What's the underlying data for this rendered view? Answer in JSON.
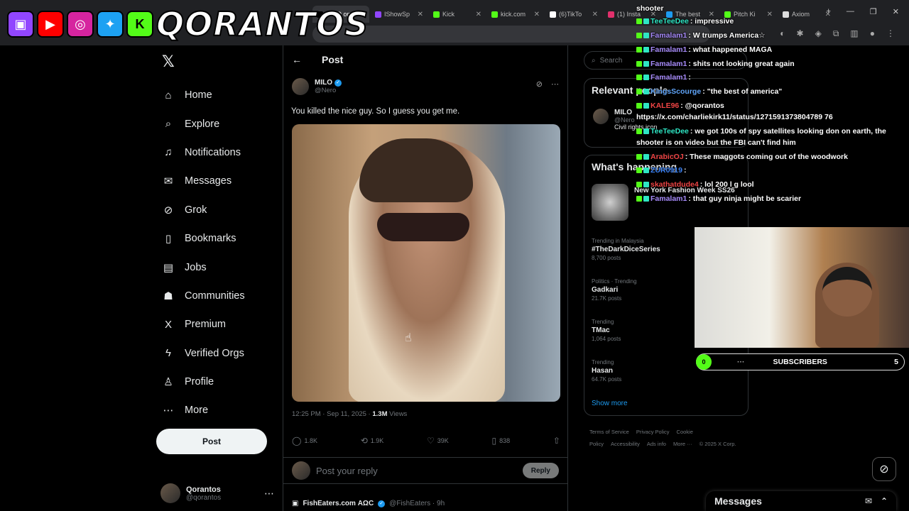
{
  "browser": {
    "tabs": [
      {
        "label": "MILO on",
        "color": "#000000",
        "active": true
      },
      {
        "label": "IShowSp",
        "color": "#9146ff",
        "active": false
      },
      {
        "label": "Kick",
        "color": "#53fc18",
        "active": false
      },
      {
        "label": "kick.com",
        "color": "#53fc18",
        "active": false
      },
      {
        "label": "(6)TikTo",
        "color": "#ffffff",
        "active": false
      },
      {
        "label": "(1) Insta",
        "color": "#e1306c",
        "active": false
      },
      {
        "label": "The best",
        "color": "#1d9bf0",
        "active": false
      },
      {
        "label": "Pitch Ki",
        "color": "#53fc18",
        "active": false
      },
      {
        "label": "Axiom",
        "color": "#dddddd",
        "active": false
      }
    ]
  },
  "overlay": {
    "brand": "QORANTOS"
  },
  "nav": {
    "items": [
      {
        "label": "Home",
        "icon": "⌂",
        "name": "home"
      },
      {
        "label": "Explore",
        "icon": "⌕",
        "name": "explore"
      },
      {
        "label": "Notifications",
        "icon": "♫",
        "name": "notifications"
      },
      {
        "label": "Messages",
        "icon": "✉",
        "name": "messages"
      },
      {
        "label": "Grok",
        "icon": "⊘",
        "name": "grok"
      },
      {
        "label": "Bookmarks",
        "icon": "▯",
        "name": "bookmarks"
      },
      {
        "label": "Jobs",
        "icon": "▤",
        "name": "jobs"
      },
      {
        "label": "Communities",
        "icon": "☗",
        "name": "communities"
      },
      {
        "label": "Premium",
        "icon": "X",
        "name": "premium"
      },
      {
        "label": "Verified Orgs",
        "icon": "ϟ",
        "name": "verified-orgs"
      },
      {
        "label": "Profile",
        "icon": "♙",
        "name": "profile"
      },
      {
        "label": "More",
        "icon": "⋯",
        "name": "more"
      }
    ],
    "post_label": "Post",
    "user": {
      "name": "Qorantos",
      "handle": "@qorantos"
    }
  },
  "post": {
    "header": "Post",
    "author": "MILO",
    "handle": "@Nero",
    "text": "You killed the nice guy. So I guess you get me.",
    "time": "12:25 PM · Sep 11, 2025 · ",
    "views": "1.3M",
    "views_label": " Views",
    "replies": "1.8K",
    "reposts": "1.9K",
    "likes": "39K",
    "bookmarks": "838",
    "reply_placeholder": "Post your reply",
    "reply_label": "Reply",
    "next_author": "FishEaters.com ΑΩϹ",
    "next_meta": "@FishEaters · 9h"
  },
  "sidebar": {
    "search": "Search",
    "relevant_title": "Relevant people",
    "relevant_name": "MILO",
    "relevant_handle": "@Nero",
    "relevant_bio": "Civil rights icon",
    "happening_title": "What's happening",
    "fashion": "New York Fashion Week SS26",
    "trends": [
      {
        "context": "Trending in Malaysia",
        "title": "#TheDarkDiceSeries",
        "count": "8,700 posts"
      },
      {
        "context": "Politics · Trending",
        "title": "Gadkari",
        "count": "21.7K posts"
      },
      {
        "context": "Trending",
        "title": "TMac",
        "count": "1,064 posts"
      },
      {
        "context": "Trending",
        "title": "Hasan",
        "count": "64.7K posts"
      }
    ],
    "show_more": "Show more",
    "footer": [
      "Terms of Service",
      "Privacy Policy",
      "Cookie Policy",
      "Accessibility",
      "Ads info",
      "More ···",
      "© 2025 X Corp."
    ]
  },
  "chat": [
    {
      "user": "",
      "text": "shooter",
      "color": "#ffffff"
    },
    {
      "user": "TeeTeeDee",
      "text": ": impressive",
      "color": "#2ee6c4"
    },
    {
      "user": "Famalam1",
      "text": ": W trumps America☆",
      "color": "#a78bfa"
    },
    {
      "user": "Famalam1",
      "text": ": what happened MAGA",
      "color": "#a78bfa"
    },
    {
      "user": "Famalam1",
      "text": ": shits not looking great again",
      "color": "#a78bfa"
    },
    {
      "user": "Famalam1",
      "text": ":",
      "color": "#a78bfa"
    },
    {
      "user": "KingsScourge",
      "text": ": \"the best of america\"",
      "color": "#60a5fa"
    },
    {
      "user": "KALE96",
      "text": ": @qorantos",
      "color": "#ef4444"
    },
    {
      "user": "",
      "text": "https://x.com/charliekirk11/status/1271591373804789 76",
      "color": "#ffffff"
    },
    {
      "user": "TeeTeeDee",
      "text": ": we got 100s of spy satellites looking don on earth, the",
      "color": "#2ee6c4"
    },
    {
      "user": "",
      "text": "shooter is on video but the FBI can't find him",
      "color": "#ffffff"
    },
    {
      "user": "ArabicOJ",
      "text": ": These maggots coming out of the woodwork",
      "color": "#ef4444"
    },
    {
      "user": "ZUR0919",
      "text": ":",
      "color": "#3b82f6"
    },
    {
      "user": "skathatdude4",
      "text": ": lol 200 l g lool",
      "color": "#ef4444"
    },
    {
      "user": "Famalam1",
      "text": ": that guy ninja might be scarier",
      "color": "#a78bfa"
    }
  ],
  "subscribers": {
    "left": "0",
    "label": "SUBSCRIBERS",
    "count": "5"
  },
  "messages_dock": "Messages"
}
